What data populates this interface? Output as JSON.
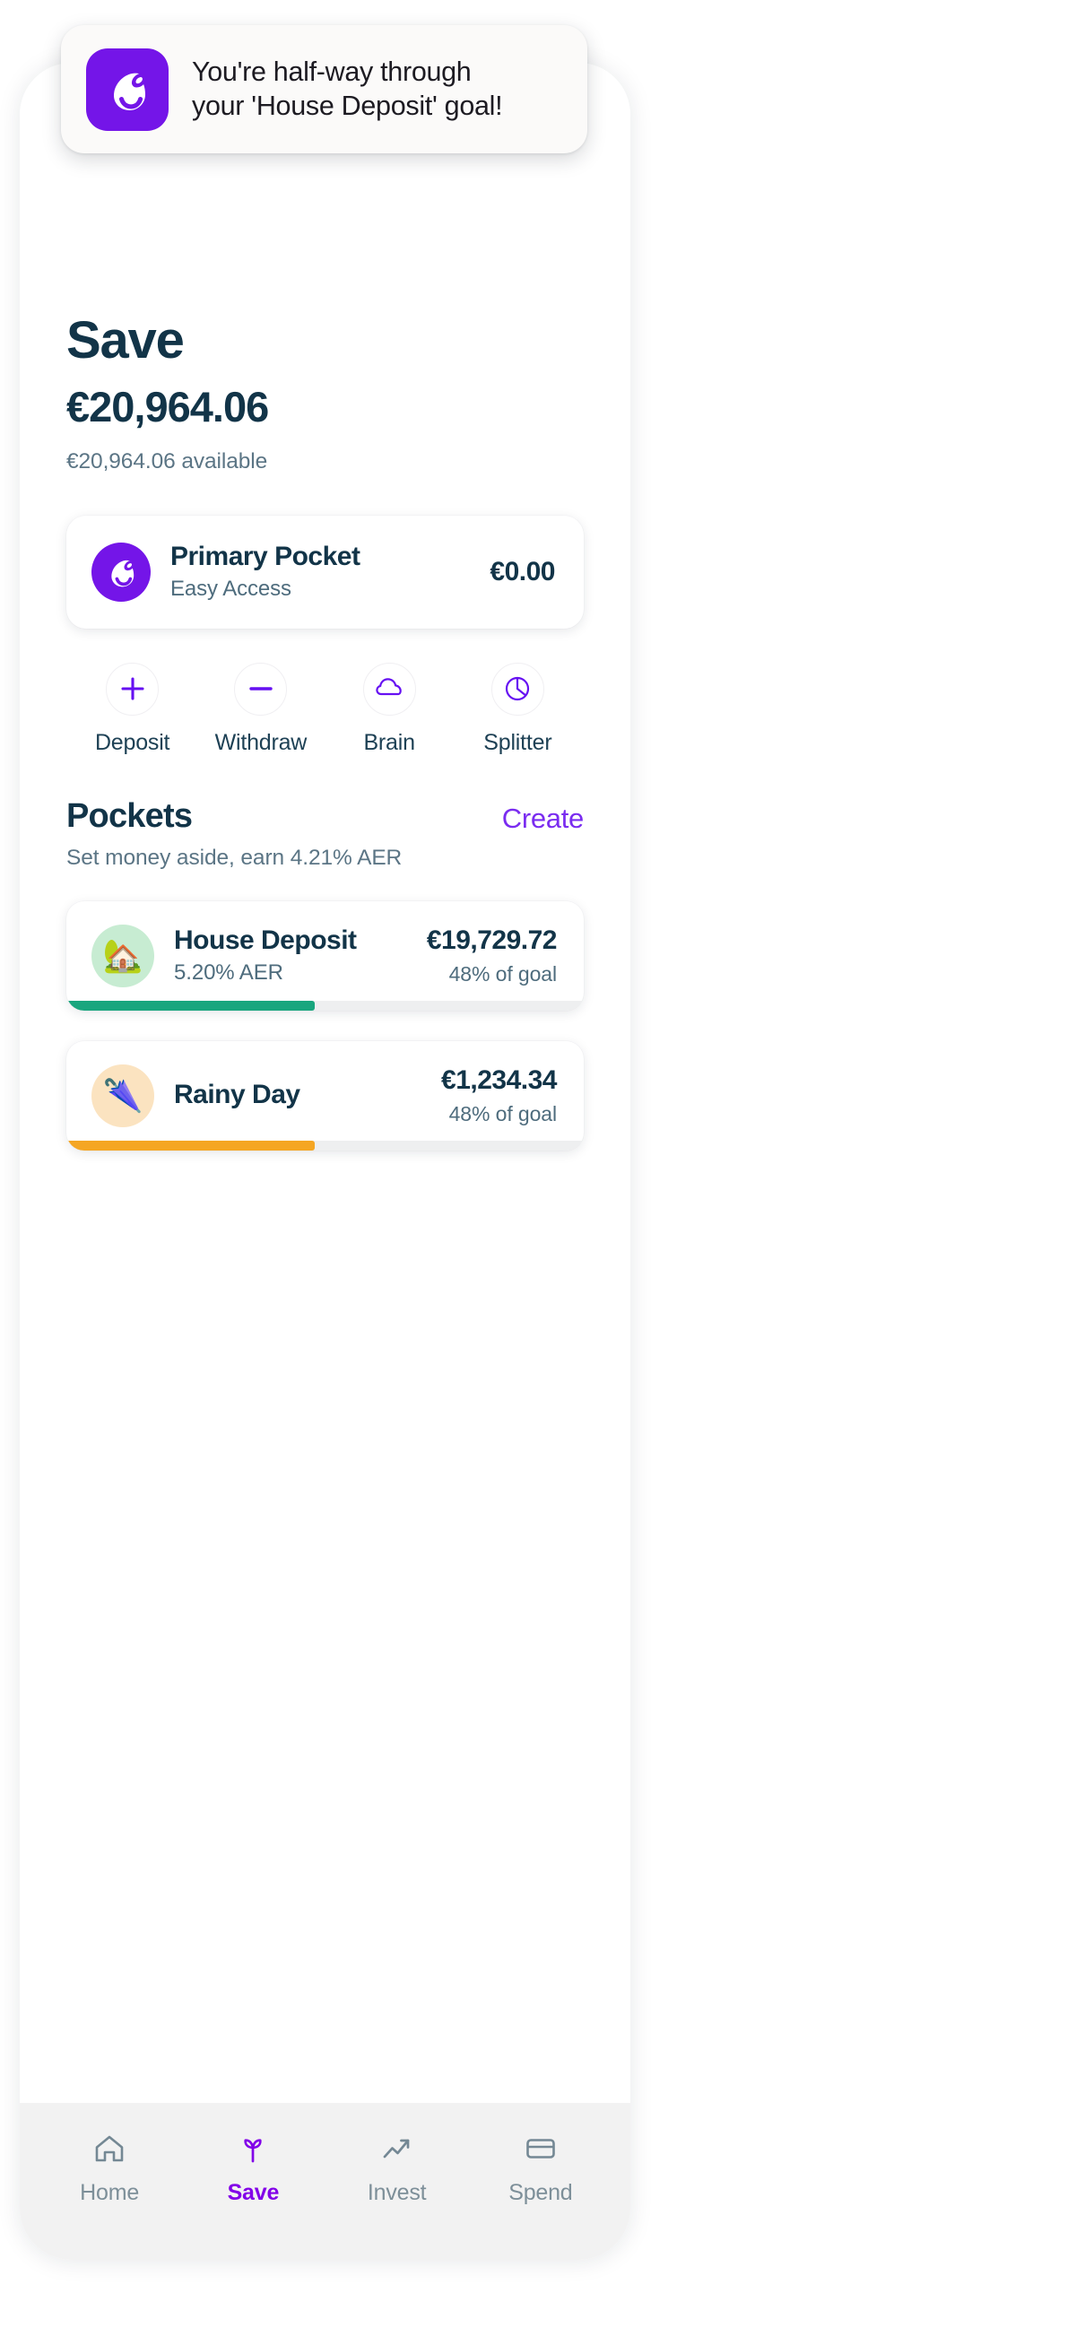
{
  "notification": {
    "app_icon": "gopay-logo-icon",
    "message_line1": "You're half-way through",
    "message_line2": "your 'House Deposit' goal!",
    "full_message": "You're half-way through your 'House Deposit' goal!"
  },
  "header": {
    "title": "Save",
    "balance": "€20,964.06",
    "available": "€20,964.06 available"
  },
  "primary_pocket": {
    "logo_icon": "gopay-logo-icon",
    "name": "Primary Pocket",
    "subtitle": "Easy Access",
    "amount": "€0.00"
  },
  "actions": [
    {
      "label": "Deposit",
      "icon": "plus-icon"
    },
    {
      "label": "Withdraw",
      "icon": "minus-icon"
    },
    {
      "label": "Brain",
      "icon": "brain-cloud-icon"
    },
    {
      "label": "Splitter",
      "icon": "pie-chart-icon"
    }
  ],
  "pockets": {
    "title": "Pockets",
    "create_label": "Create",
    "subtitle": "Set money aside, earn 4.21% AER",
    "items": [
      {
        "emoji": "🏡",
        "emoji_name": "house-with-garden-emoji",
        "emoji_bg": "#c7ecd2",
        "name": "House Deposit",
        "aer": "5.20% AER",
        "amount": "€19,729.72",
        "goal_label": "48% of goal",
        "progress_percent": 48,
        "progress_color": "#19a67e"
      },
      {
        "emoji": "🌂",
        "emoji_name": "closed-umbrella-emoji",
        "emoji_bg": "#fbe3c0",
        "name": "Rainy Day",
        "aer": "",
        "amount": "€1,234.34",
        "goal_label": "48% of goal",
        "progress_percent": 48,
        "progress_color": "#f5a623"
      }
    ]
  },
  "bottom_nav": {
    "items": [
      {
        "label": "Home",
        "icon": "home-icon",
        "active": false
      },
      {
        "label": "Save",
        "icon": "sprout-icon",
        "active": true
      },
      {
        "label": "Invest",
        "icon": "chart-arrow-icon",
        "active": false
      },
      {
        "label": "Spend",
        "icon": "card-icon",
        "active": false
      }
    ]
  },
  "colors": {
    "brand_purple": "#7415e8",
    "accent_purple": "#8200e8",
    "navy": "#123448",
    "muted": "#5b7585",
    "green": "#19a67e",
    "orange": "#f5a623"
  }
}
